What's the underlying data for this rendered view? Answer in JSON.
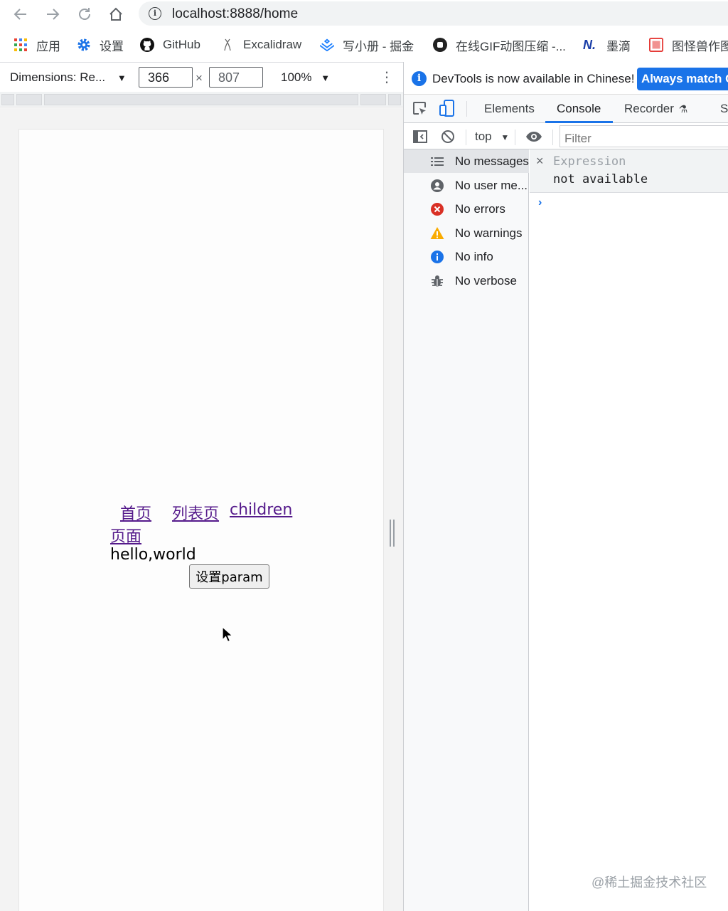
{
  "browser": {
    "url": "localhost:8888/home",
    "bookmarks": [
      {
        "label": "应用",
        "icon": "apps-grid-icon"
      },
      {
        "label": "设置",
        "icon": "gear-icon"
      },
      {
        "label": "GitHub",
        "icon": "github-icon"
      },
      {
        "label": "Excalidraw",
        "icon": "excalidraw-icon"
      },
      {
        "label": "写小册 - 掘金",
        "icon": "juejin-icon"
      },
      {
        "label": "在线GIF动图压缩 -...",
        "icon": "gif-tool-icon"
      },
      {
        "label": "墨滴",
        "icon": "modi-icon"
      },
      {
        "label": "图怪兽作图",
        "icon": "tuguaishou-icon"
      }
    ]
  },
  "device_toolbar": {
    "dimensions_label": "Dimensions: Re...",
    "width": "366",
    "height": "807",
    "times": "×",
    "zoom": "100%"
  },
  "page": {
    "links": [
      "首页",
      "列表页",
      "children",
      "页面"
    ],
    "text": "hello,world",
    "button_label": "设置param"
  },
  "devtools": {
    "banner_message": "DevTools is now available in Chinese!",
    "banner_button": "Always match C",
    "tabs": [
      "Elements",
      "Console",
      "Recorder",
      "S"
    ],
    "active_tab": "Console",
    "context": "top",
    "filter_placeholder": "Filter",
    "sidebar": [
      {
        "label": "No messages",
        "icon": "list-icon"
      },
      {
        "label": "No user me...",
        "icon": "user-icon"
      },
      {
        "label": "No errors",
        "icon": "error-icon"
      },
      {
        "label": "No warnings",
        "icon": "warning-icon"
      },
      {
        "label": "No info",
        "icon": "info-icon"
      },
      {
        "label": "No verbose",
        "icon": "bug-icon"
      }
    ],
    "expression_label": "Expression",
    "expression_value": "not available",
    "accent_color": "#1a73e8"
  },
  "watermark": "@稀土掘金技术社区"
}
